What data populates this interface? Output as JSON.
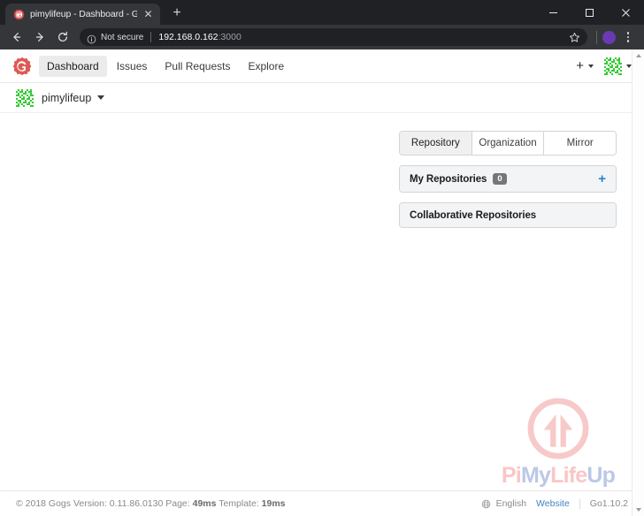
{
  "browser": {
    "tab": {
      "title": "pimylifeup - Dashboard - Gogs",
      "favicon": "gogs-logo-icon",
      "close_label": "✕"
    },
    "new_tab_label": "+",
    "window_controls": {
      "minimize": "minimize-icon",
      "maximize": "maximize-icon",
      "close": "close-icon"
    },
    "toolbar": {
      "back": "back-arrow-icon",
      "forward": "forward-arrow-icon",
      "reload": "reload-icon",
      "security_label": "Not secure",
      "url_host": "192.168.0.162",
      "url_port": ":3000",
      "bookmark": "star-icon",
      "profile": "profile-avatar",
      "menu": "kebab-menu-icon"
    }
  },
  "gogs": {
    "logo": "gogs-logo-icon",
    "nav": [
      {
        "label": "Dashboard",
        "active": true
      },
      {
        "label": "Issues",
        "active": false
      },
      {
        "label": "Pull Requests",
        "active": false
      },
      {
        "label": "Explore",
        "active": false
      }
    ],
    "nav_right": {
      "create_label": "+",
      "avatar": "user-identicon"
    },
    "context": {
      "avatar": "user-identicon",
      "username": "pimylifeup"
    },
    "right_panel": {
      "tabs": [
        {
          "label": "Repository",
          "active": true
        },
        {
          "label": "Organization",
          "active": false
        },
        {
          "label": "Mirror",
          "active": false
        }
      ],
      "my_repositories": {
        "title": "My Repositories",
        "count": "0",
        "add_label": "+"
      },
      "collaborative": {
        "title": "Collaborative Repositories"
      }
    },
    "footer": {
      "copyright": "© 2018 Gogs Version: 0.11.86.0130 Page:",
      "page_time": "49ms",
      "template_label": "Template:",
      "template_time": "19ms",
      "language": "English",
      "website": "Website",
      "go_version": "Go1.10.2"
    }
  },
  "watermark": {
    "part1": "Pi",
    "part2": "My",
    "part3": "Life",
    "part4": "Up"
  },
  "colors": {
    "gogs_red": "#d9534f",
    "link_blue": "#4183c4",
    "accent_blue": "#2185d0",
    "identicon_green": "#33cc33",
    "chrome_dark": "#202124",
    "chrome_toolbar": "#35363a",
    "watermark_pink": "#f9c6c6",
    "watermark_blue": "#bcc8e8"
  }
}
